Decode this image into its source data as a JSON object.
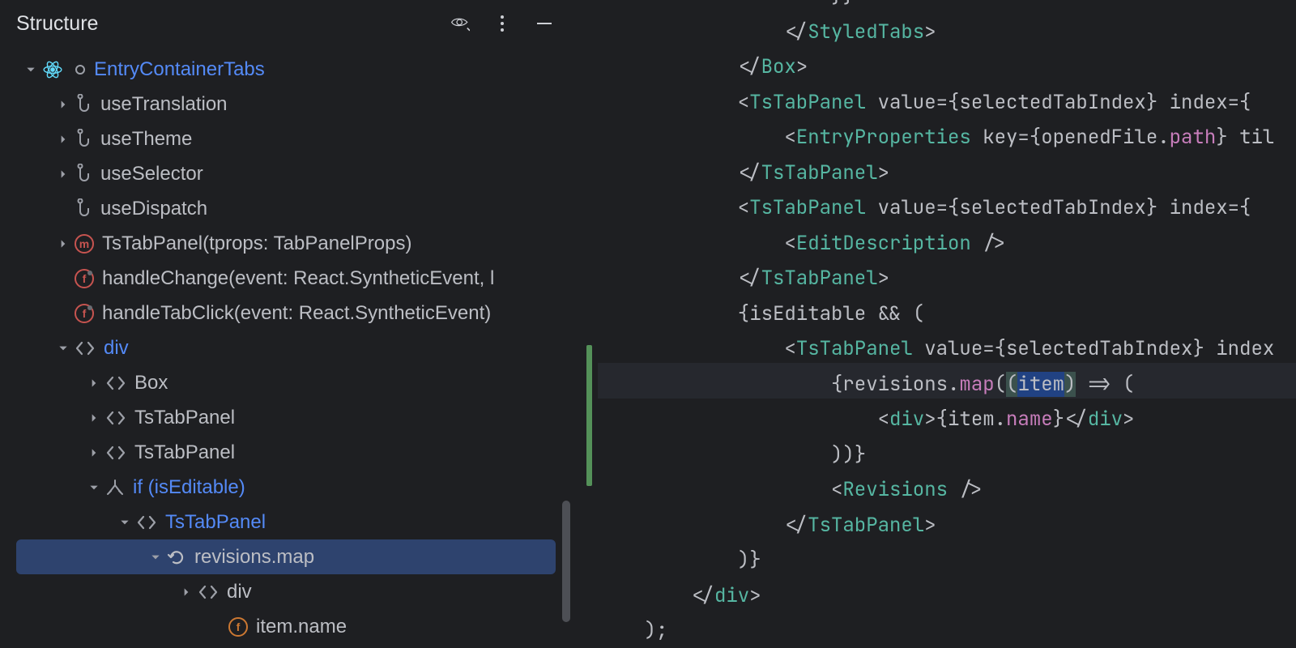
{
  "panel": {
    "title": "Structure"
  },
  "tree": {
    "root": {
      "label": "EntryContainerTabs",
      "children": [
        {
          "label": "useTranslation",
          "icon": "hook"
        },
        {
          "label": "useTheme",
          "icon": "hook"
        },
        {
          "label": "useSelector",
          "icon": "hook"
        },
        {
          "label": "useDispatch",
          "icon": "hook"
        },
        {
          "label": "TsTabPanel(tprops: TabPanelProps)",
          "icon": "method-m"
        },
        {
          "label": "handleChange(event: React.SyntheticEvent, l",
          "icon": "func-red"
        },
        {
          "label": "handleTabClick(event: React.SyntheticEvent)",
          "icon": "func-red"
        },
        {
          "label": "div",
          "icon": "tag",
          "blue": true,
          "children": [
            {
              "label": "Box",
              "icon": "tag"
            },
            {
              "label": "TsTabPanel",
              "icon": "tag"
            },
            {
              "label": "TsTabPanel",
              "icon": "tag"
            },
            {
              "label": "if (isEditable)",
              "icon": "branch",
              "blue": true,
              "children": [
                {
                  "label": "TsTabPanel",
                  "icon": "tag",
                  "blue": true,
                  "children": [
                    {
                      "label": "revisions.map",
                      "icon": "loop",
                      "selected": true,
                      "children": [
                        {
                          "label": "div",
                          "icon": "tag",
                          "children": [
                            {
                              "label": "item.name",
                              "icon": "func-orange"
                            }
                          ]
                        }
                      ]
                    }
                  ]
                }
              ]
            }
          ]
        }
      ]
    }
  },
  "code": {
    "indent_guides": [
      4,
      6,
      8
    ],
    "lines": [
      {
        "i": 10,
        "html": "}}"
      },
      {
        "i": 8,
        "html": "</<tn>StyledTabs</tn>>"
      },
      {
        "i": 6,
        "html": "</<tn>Box</tn>>"
      },
      {
        "i": 6,
        "html": "<<tn>TsTabPanel</tn> <an>value</an>={<id>selectedTabIndex</id>} <an>index</an>={"
      },
      {
        "i": 8,
        "html": "<<tn>EntryProperties</tn> <an>key</an>={<id>openedFile</id>.<pp>path</pp>} <an>til</an>"
      },
      {
        "i": 6,
        "html": "</<tn>TsTabPanel</tn>>"
      },
      {
        "i": 6,
        "html": "<<tn>TsTabPanel</tn> <an>value</an>={<id>selectedTabIndex</id>} <an>index</an>={"
      },
      {
        "i": 8,
        "html": "<<tn>EditDescription</tn> />"
      },
      {
        "i": 6,
        "html": "</<tn>TsTabPanel</tn>>"
      },
      {
        "i": 6,
        "html": "{<id>isEditable</id> && ("
      },
      {
        "i": 8,
        "html": "<<tn>TsTabPanel</tn> <an>value</an>={<id>selectedTabIndex</id>} <an>index</an>"
      },
      {
        "i": 10,
        "html": "{<id>revisions</id>.<mp>map</mp>(<ph>(</ph><cb>item</cb><ph>)</ph> => (",
        "hl": true
      },
      {
        "i": 12,
        "html": "<<tn>div</tn>>{<id>item</id>.<pp>name</pp>}</<tn>div</tn>>"
      },
      {
        "i": 10,
        "html": "))}"
      },
      {
        "i": 10,
        "html": "<<tn>Revisions</tn> />"
      },
      {
        "i": 8,
        "html": "</<tn>TsTabPanel</tn>>"
      },
      {
        "i": 6,
        "html": ")}"
      },
      {
        "i": 4,
        "html": "</<tn>div</tn>>"
      },
      {
        "i": 2,
        "html": ");"
      }
    ]
  }
}
